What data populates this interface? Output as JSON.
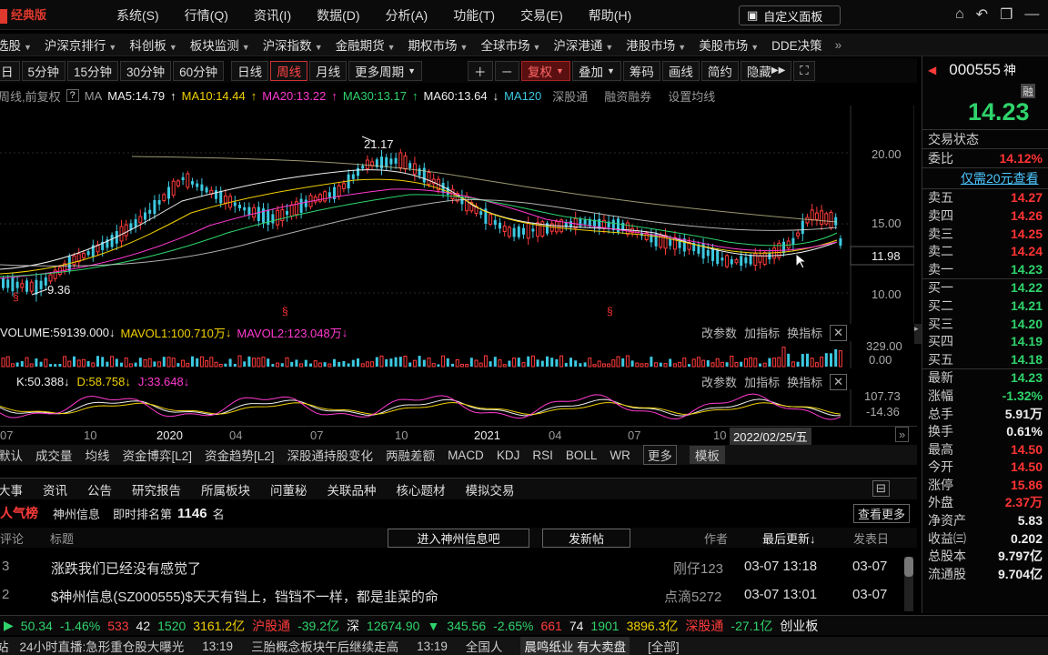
{
  "title": {
    "logo": "经典版",
    "menu": [
      "系统(S)",
      "行情(Q)",
      "资讯(I)",
      "数据(D)",
      "分析(A)",
      "功能(T)",
      "交易(E)",
      "帮助(H)"
    ],
    "custom_panel": "自定义面板"
  },
  "nav": [
    "选股",
    "沪深京排行",
    "科创板",
    "板块监测",
    "沪深指数",
    "金融期货",
    "期权市场",
    "全球市场",
    "沪深港通",
    "港股市场",
    "美股市场",
    "DDE决策"
  ],
  "periods": [
    "日",
    "5分钟",
    "15分钟",
    "30分钟",
    "60分钟",
    "日线",
    "周线",
    "月线",
    "更多周期",
    "复权",
    "叠加",
    "筹码",
    "画线",
    "简约",
    "隐藏"
  ],
  "ma": {
    "label": "周线,前复权",
    "ma": "MA",
    "ma5": "MA5:14.79",
    "ma10": "MA10:14.44",
    "ma20": "MA20:13.22",
    "ma30": "MA30:13.17",
    "ma60": "MA60:13.64",
    "ma120": "MA120",
    "sgt": "深股通",
    "rzrq": "融资融券",
    "settings": "设置均线"
  },
  "chart_data": [
    {
      "type": "candlestick",
      "title": "",
      "price_axis": [
        "20.00",
        "15.00",
        "11.98",
        "10.00"
      ],
      "annotations": [
        "21.17",
        "9.36"
      ],
      "x_ticks": [
        "07",
        "10",
        "2020",
        "04",
        "07",
        "10",
        "2021",
        "04",
        "07",
        "10",
        "2022/02/25/五"
      ],
      "ylim": [
        9,
        22
      ]
    },
    {
      "type": "bar",
      "title": "VOLUME:59139.000",
      "series": [
        {
          "name": "MAVOL1:100.710万"
        },
        {
          "name": "MAVOL2:123.048万"
        }
      ],
      "axis": [
        "329.00",
        "0.00"
      ]
    },
    {
      "type": "line",
      "series": [
        {
          "name": "K:50.388"
        },
        {
          "name": "D:58.758"
        },
        {
          "name": "J:33.648"
        }
      ],
      "axis": [
        "107.73",
        "-14.36"
      ]
    }
  ],
  "panel_tools": [
    "改参数",
    "加指标",
    "换指标"
  ],
  "ind_tabs": [
    "默认",
    "成交量",
    "均线",
    "资金博弈[L2]",
    "资金趋势[L2]",
    "深股通持股变化",
    "两融差额",
    "MACD",
    "KDJ",
    "RSI",
    "BOLL",
    "WR",
    "更多",
    "模板"
  ],
  "bottom_tabs": [
    "大事",
    "资讯",
    "公告",
    "研究报告",
    "所属板块",
    "问董秘",
    "关联品种",
    "核心题材",
    "模拟交易"
  ],
  "rank": {
    "title": "人气榜",
    "name": "神州信息",
    "label": "即时排名第",
    "num": "1146",
    "unit": "名",
    "more": "查看更多"
  },
  "thead": {
    "c1": "评论",
    "c2": "标题",
    "btn1": "进入神州信息吧",
    "btn2": "发新帖",
    "c3": "作者",
    "c4": "最后更新↓",
    "c5": "发表日"
  },
  "rows": [
    {
      "n": "3",
      "t": "涨跌我们已经没有感觉了",
      "a": "刚仔123",
      "u": "03-07 13:18",
      "d": "03-07"
    },
    {
      "n": "2",
      "t": "$神州信息(SZ000555)$天天有铛上，铛铛不一样，都是韭菜的命",
      "a": "点滴5272",
      "u": "03-07 13:01",
      "d": "03-07"
    }
  ],
  "quote": {
    "code": "000555",
    "name": "神",
    "tag": "融",
    "price": "14.23",
    "state": "交易状态",
    "wb": "委比",
    "wbv": "14.12%",
    "ad": "仅需20元查看",
    "sells": [
      [
        "卖五",
        "14.27"
      ],
      [
        "卖四",
        "14.26"
      ],
      [
        "卖三",
        "14.25"
      ],
      [
        "卖二",
        "14.24"
      ],
      [
        "卖一",
        "14.23"
      ]
    ],
    "buys": [
      [
        "买一",
        "14.22"
      ],
      [
        "买二",
        "14.21"
      ],
      [
        "买三",
        "14.20"
      ],
      [
        "买四",
        "14.19"
      ],
      [
        "买五",
        "14.18"
      ]
    ],
    "stats": [
      [
        "最新",
        "14.23"
      ],
      [
        "涨幅",
        "-1.32%"
      ],
      [
        "总手",
        "5.91万"
      ],
      [
        "换手",
        "0.61%"
      ],
      [
        "最高",
        "14.50"
      ],
      [
        "今开",
        "14.50"
      ],
      [
        "涨停",
        "15.86"
      ],
      [
        "外盘",
        "2.37万"
      ],
      [
        "净资产",
        "5.83"
      ],
      [
        "收益㈢",
        "0.202"
      ],
      [
        "总股本",
        "9.797亿"
      ],
      [
        "流通股",
        "9.704亿"
      ]
    ]
  },
  "ticker": [
    "50.34",
    "-1.46%",
    "533",
    "42",
    "1520",
    "3161.2亿",
    "沪股通",
    "-39.2亿",
    "深",
    "12674.90",
    "345.56",
    "-2.65%",
    "661",
    "74",
    "1901",
    "3896.3亿",
    "深股通",
    "-27.1亿",
    "创业板"
  ],
  "news": [
    "24小时直播:急形重仓股大曝光",
    "13:19",
    "三胎概念板块午后继续走高",
    "13:19",
    "全国人",
    "晨鸣纸业 有大卖盘",
    "[全部]"
  ]
}
